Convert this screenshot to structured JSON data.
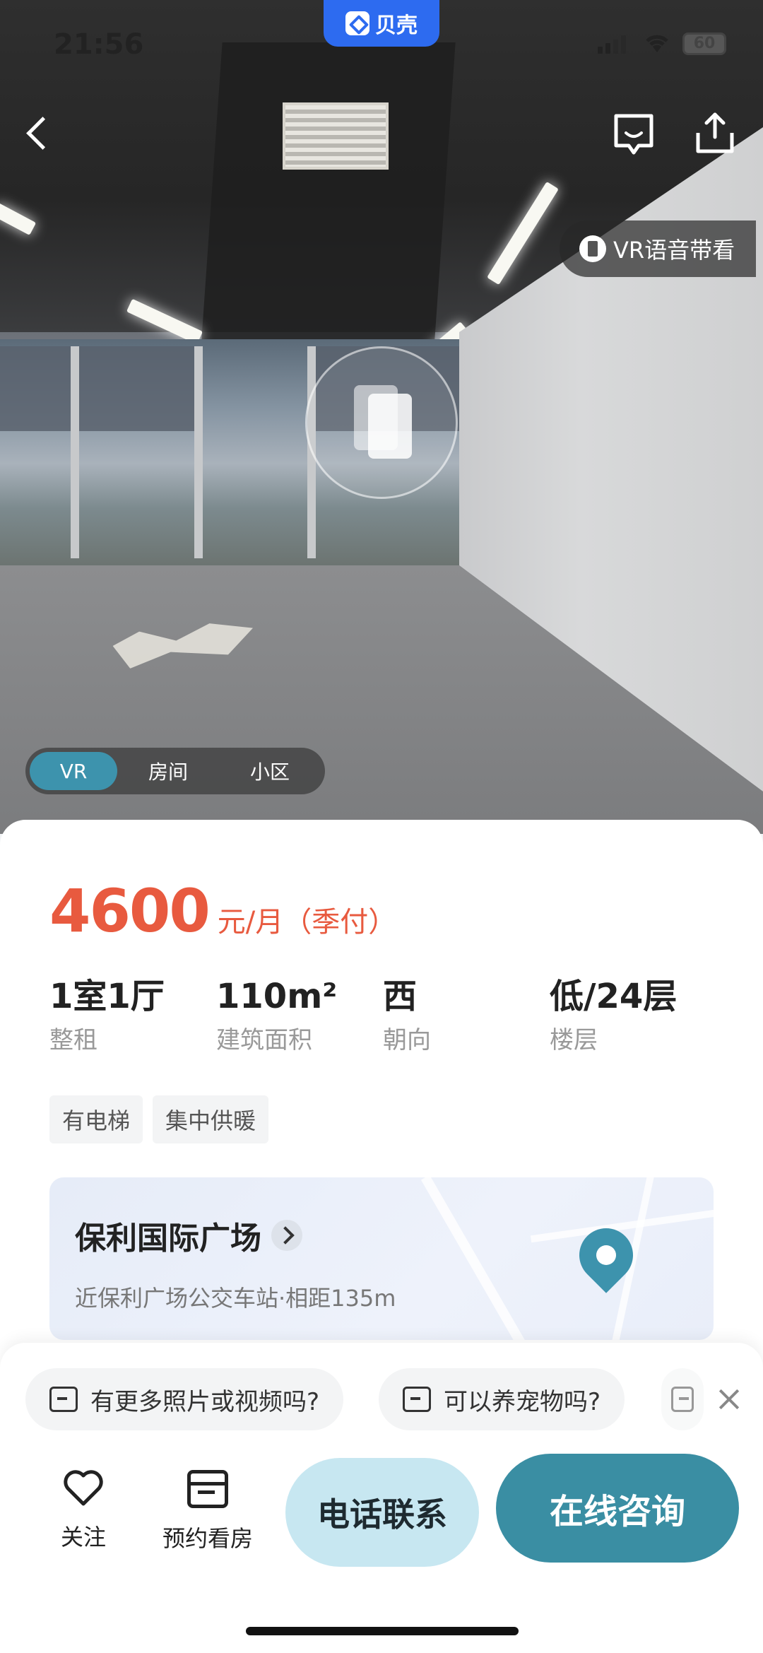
{
  "status_bar": {
    "time": "21:56",
    "battery": "60"
  },
  "brand": {
    "name": "贝壳"
  },
  "vr": {
    "voice_label": "VR语音带看",
    "modes": [
      "VR",
      "房间",
      "小区"
    ],
    "active_mode": "VR"
  },
  "listing": {
    "price": "4600",
    "price_unit": "元/月（季付）",
    "specs": [
      {
        "value": "1室1厅",
        "label": "整租"
      },
      {
        "value": "110m²",
        "label": "建筑面积"
      },
      {
        "value": "西",
        "label": "朝向"
      },
      {
        "value": "低/24层",
        "label": "楼层"
      }
    ],
    "tags": [
      "有电梯",
      "集中供暖"
    ],
    "location": {
      "name": "保利国际广场",
      "sub": "近保利广场公交车站·相距135m"
    }
  },
  "quick_questions": [
    "有更多照片或视频吗?",
    "可以养宠物吗?"
  ],
  "actions": {
    "follow": "关注",
    "schedule": "预约看房",
    "call": "电话联系",
    "online": "在线咨询"
  },
  "colors": {
    "price": "#e85a3f",
    "accent": "#3a8ea3",
    "call_bg": "#c7e7f1",
    "brand": "#2d6bf0"
  },
  "icons": [
    "back-icon",
    "chat-icon",
    "share-icon",
    "vr-icon",
    "map-pin-icon",
    "heart-icon",
    "calendar-icon",
    "close-icon"
  ]
}
